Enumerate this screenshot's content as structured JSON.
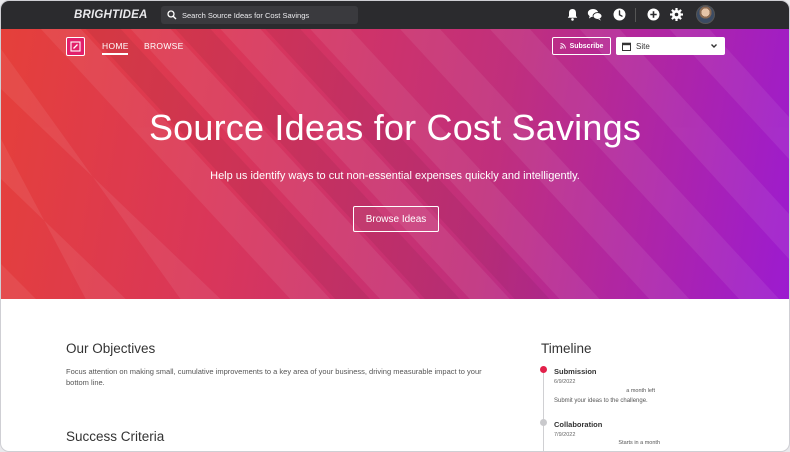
{
  "topbar": {
    "logo": "BRIGHTIDEA",
    "search_placeholder": "Search Source Ideas for Cost Savings",
    "icons": [
      "bell-icon",
      "chat-icon",
      "clock-icon",
      "plus-icon",
      "gear-icon",
      "avatar"
    ]
  },
  "nav": {
    "home": "HOME",
    "browse": "BROWSE",
    "subscribe": "Subscribe",
    "site_select": "Site"
  },
  "hero": {
    "title": "Source Ideas for Cost Savings",
    "subtitle": "Help us identify ways to cut non-essential expenses quickly and intelligently.",
    "button": "Browse Ideas"
  },
  "content": {
    "objectives_title": "Our Objectives",
    "objectives_text": "Focus attention on making small, cumulative improvements to a key area of your business, driving measurable impact to your bottom line.",
    "success_title": "Success Criteria"
  },
  "timeline": {
    "title": "Timeline",
    "phases": [
      {
        "name": "Submission",
        "date": "6/9/2022",
        "relative": "a month left",
        "description": "Submit your ideas to the challenge.",
        "color": "#e2204a"
      },
      {
        "name": "Collaboration",
        "date": "7/9/2022",
        "relative": "Starts in a month",
        "description": "",
        "color": "#c9c9cc"
      }
    ]
  },
  "colors": {
    "topbar": "#2b2b2e",
    "hero_start": "#e5403a",
    "hero_end": "#9c1bd0",
    "accent": "#e2206b"
  }
}
